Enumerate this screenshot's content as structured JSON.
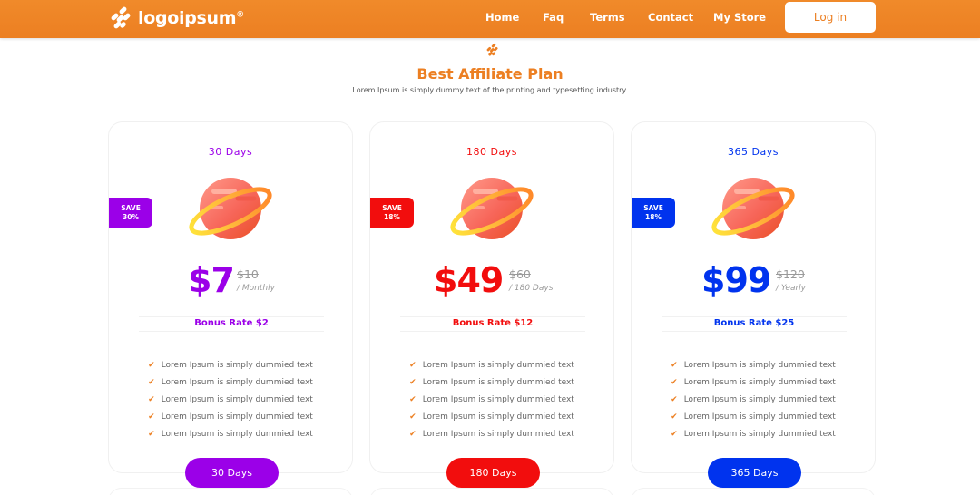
{
  "brand": {
    "name": "logoipsum",
    "mark": "®"
  },
  "nav": {
    "links": [
      "Home",
      "Faq",
      "Terms",
      "Contact",
      "My Store"
    ],
    "login_label": "Log in"
  },
  "section": {
    "icon": "logo-mark-icon",
    "title": "Best Affiliate Plan",
    "subtitle": "Lorem Ipsum is simply dummy text of the printing and typesetting industry."
  },
  "colors": {
    "brand_orange": "#ec7f22",
    "purple": "#9b00e8",
    "red": "#f20d0d",
    "blue": "#0033ee"
  },
  "plans": [
    {
      "duration": "30 Days",
      "save_label": "SAVE",
      "save_value": "30%",
      "price": "$7",
      "old_price": "$10",
      "period": "/ Monthly",
      "bonus": "Bonus Rate $2",
      "features": [
        "Lorem Ipsum is simply dummied text",
        "Lorem Ipsum is simply dummied text",
        "Lorem Ipsum is simply dummied text",
        "Lorem Ipsum is simply dummied text",
        "Lorem Ipsum is simply dummied text"
      ],
      "cta": "30 Days",
      "accent": "#9b00e8"
    },
    {
      "duration": "180 Days",
      "save_label": "SAVE",
      "save_value": "18%",
      "price": "$49",
      "old_price": "$60",
      "period": "/ 180 Days",
      "bonus": "Bonus Rate $12",
      "features": [
        "Lorem Ipsum is simply dummied text",
        "Lorem Ipsum is simply dummied text",
        "Lorem Ipsum is simply dummied text",
        "Lorem Ipsum is simply dummied text",
        "Lorem Ipsum is simply dummied text"
      ],
      "cta": "180 Days",
      "accent": "#f20d0d"
    },
    {
      "duration": "365 Days",
      "save_label": "SAVE",
      "save_value": "18%",
      "price": "$99",
      "old_price": "$120",
      "period": "/ Yearly",
      "bonus": "Bonus Rate $25",
      "features": [
        "Lorem Ipsum is simply dummied text",
        "Lorem Ipsum is simply dummied text",
        "Lorem Ipsum is simply dummied text",
        "Lorem Ipsum is simply dummied text",
        "Lorem Ipsum is simply dummied text"
      ],
      "cta": "365 Days",
      "accent": "#0033ee"
    }
  ]
}
